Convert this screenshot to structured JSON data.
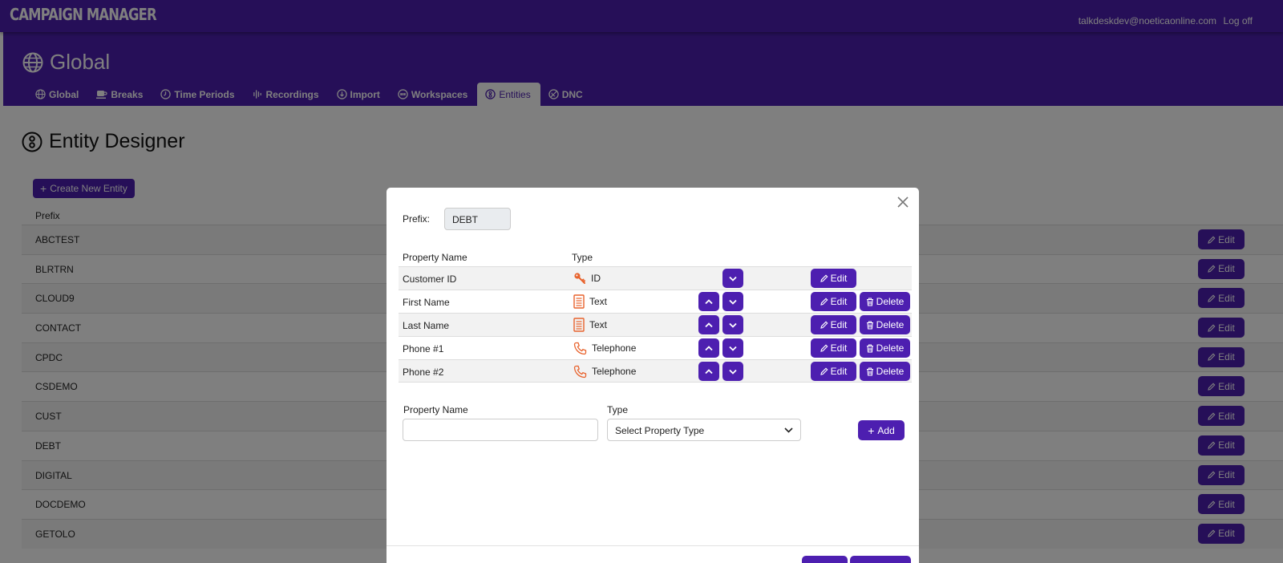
{
  "app": {
    "brand": "CAMPAIGN MANAGER",
    "user_email": "talkdeskdev@noeticaonline.com",
    "logoff_label": "Log off"
  },
  "header": {
    "title": "Global",
    "tabs": [
      {
        "label": "Global",
        "icon": "globe-icon"
      },
      {
        "label": "Breaks",
        "icon": "coffee-icon"
      },
      {
        "label": "Time Periods",
        "icon": "clock-icon"
      },
      {
        "label": "Recordings",
        "icon": "waveform-icon"
      },
      {
        "label": "Import",
        "icon": "import-icon"
      },
      {
        "label": "Workspaces",
        "icon": "workspaces-icon"
      },
      {
        "label": "Entities",
        "icon": "entities-icon",
        "active": true
      },
      {
        "label": "DNC",
        "icon": "dnc-icon"
      }
    ]
  },
  "page": {
    "title": "Entity Designer"
  },
  "list": {
    "create_label": "Create New Entity",
    "column_prefix": "Prefix",
    "edit_label": "Edit",
    "rows": [
      "ABCTEST",
      "BLRTRN",
      "CLOUD9",
      "CONTACT",
      "CPDC",
      "CSDEMO",
      "CUST",
      "DEBT",
      "DIGITAL",
      "DOCDEMO",
      "GETOLO"
    ]
  },
  "modal": {
    "prefix_label": "Prefix:",
    "prefix_value": "DEBT",
    "col_property_name": "Property Name",
    "col_type": "Type",
    "edit_label": "Edit",
    "delete_label": "Delete",
    "properties": [
      {
        "name": "Customer ID",
        "type": "ID",
        "icon": "key-icon",
        "can_move_up": false,
        "can_move_down": true,
        "deletable": false
      },
      {
        "name": "First Name",
        "type": "Text",
        "icon": "document-icon",
        "can_move_up": true,
        "can_move_down": true,
        "deletable": true
      },
      {
        "name": "Last Name",
        "type": "Text",
        "icon": "document-icon",
        "can_move_up": true,
        "can_move_down": true,
        "deletable": true
      },
      {
        "name": "Phone #1",
        "type": "Telephone",
        "icon": "phone-icon",
        "can_move_up": true,
        "can_move_down": true,
        "deletable": true
      },
      {
        "name": "Phone #2",
        "type": "Telephone",
        "icon": "phone-icon",
        "can_move_up": true,
        "can_move_down": true,
        "deletable": true
      }
    ],
    "new_property": {
      "name_label": "Property Name",
      "name_value": "",
      "type_label": "Type",
      "type_value": "Select Property Type",
      "add_label": "Add"
    }
  },
  "colors": {
    "primary": "#4d1fb0",
    "icon_orange": "#e8622c",
    "overlay": "rgba(0,0,0,0.5)"
  }
}
